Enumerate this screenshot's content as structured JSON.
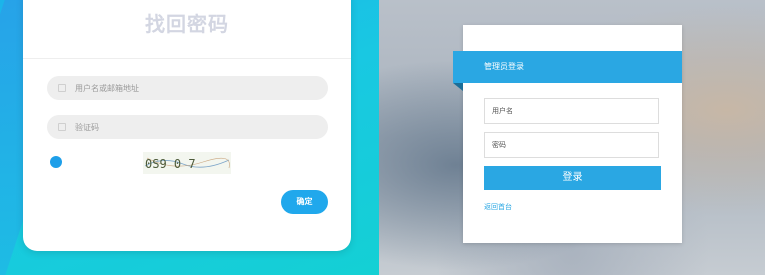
{
  "recover": {
    "title": "找回密码",
    "username_placeholder": "用户名或邮箱地址",
    "captcha_placeholder": "验证码",
    "captcha_text": "0S9 0 7",
    "confirm_label": "确定"
  },
  "login": {
    "header": "管理员登录",
    "username_placeholder": "用户名",
    "password_placeholder": "密码",
    "login_label": "登录",
    "back_link": "返回首台"
  },
  "colors": {
    "primary_blue": "#2aa7e3",
    "left_gradient_start": "#1bb4ea",
    "left_gradient_end": "#14d0d4",
    "title_gray": "#d3d6e2"
  },
  "icons": {
    "field_icon": "field-icon",
    "captcha_status": "status-dot"
  }
}
